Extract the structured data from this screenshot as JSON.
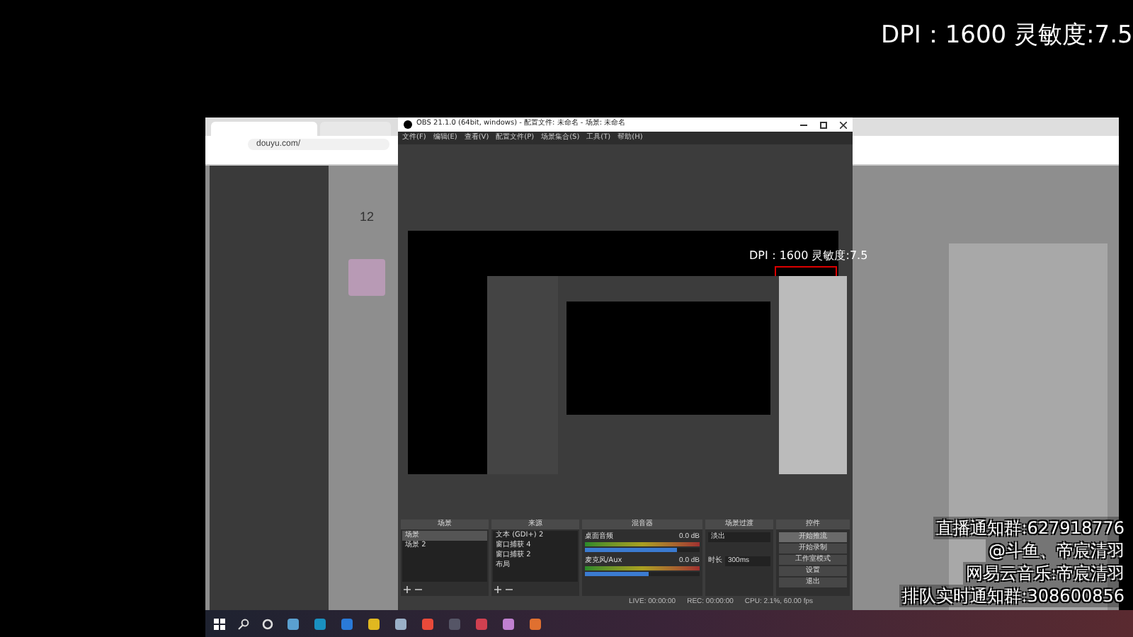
{
  "overlay": {
    "dpi_text": "DPI：1600 灵敏度:7.5",
    "notices": [
      "直播通知群:627918776",
      "@斗鱼、帝宸清羽",
      "网易云音乐:帝宸清羽",
      "排队实时通知群:308600856"
    ]
  },
  "browser": {
    "address": "douyu.com/",
    "follower_count": "12"
  },
  "obs": {
    "title": "OBS 21.1.0 (64bit, windows) - 配置文件: 未命名 - 场景: 未命名",
    "menu": [
      "文件(F)",
      "编辑(E)",
      "查看(V)",
      "配置文件(P)",
      "场景集合(S)",
      "工具(T)",
      "帮助(H)"
    ],
    "preview_text": "DPI：1600 灵敏度:7.5",
    "panels": [
      "场景",
      "来源",
      "混音器",
      "场景过渡",
      "控件"
    ],
    "scenes": [
      {
        "label": "场景",
        "selected": true
      },
      {
        "label": "场景 2",
        "selected": false
      }
    ],
    "sources": [
      "文本 (GDI+) 2",
      "窗口捕获 4",
      "窗口捕获 2",
      "布局"
    ],
    "mixer": [
      {
        "name": "桌面音频",
        "reading": "0.0 dB",
        "level": 0.8
      },
      {
        "name": "麦克风/Aux",
        "reading": "0.0 dB",
        "level": 0.55
      }
    ],
    "transition": {
      "value": "淡出",
      "duration_label": "时长",
      "duration": "300ms"
    },
    "controls": [
      {
        "label": "开始推流",
        "selected": true
      },
      {
        "label": "开始录制",
        "selected": false
      },
      {
        "label": "工作室模式",
        "selected": false
      },
      {
        "label": "设置",
        "selected": false
      },
      {
        "label": "退出",
        "selected": false
      }
    ],
    "status": [
      "LIVE: 00:00:00",
      "REC: 00:00:00",
      "CPU: 2.1%, 60.00 fps"
    ]
  }
}
